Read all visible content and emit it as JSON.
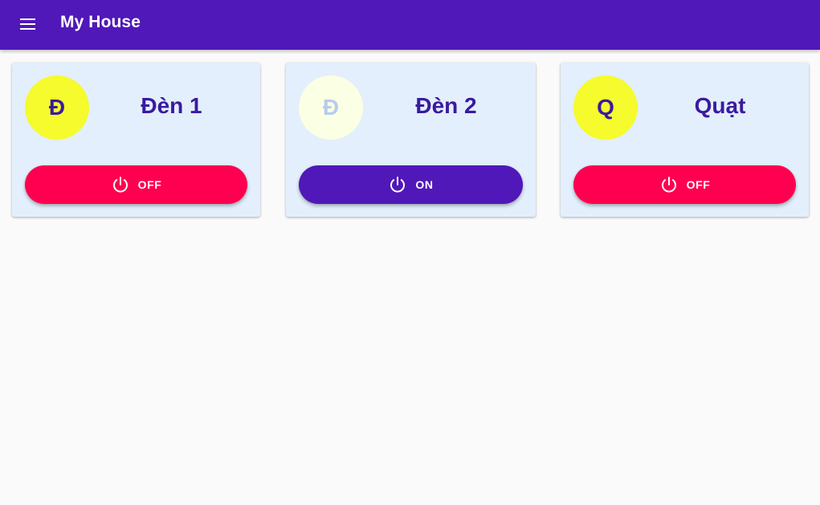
{
  "app_bar": {
    "title": "My House",
    "menu_icon": "menu-icon",
    "background": "#5018b8"
  },
  "devices": [
    {
      "initial": "Đ",
      "name": "Đèn 1",
      "state_label": "OFF",
      "state": "off",
      "avatar_bg": "#f5fb2c",
      "avatar_fg": "#3a1aa0",
      "button_color": "#ff0050",
      "icon": "power-icon"
    },
    {
      "initial": "Đ",
      "name": "Đèn 2",
      "state_label": "ON",
      "state": "on",
      "avatar_bg": "#fbffe3",
      "avatar_fg": "#b5ccef",
      "button_color": "#5018b8",
      "icon": "power-icon"
    },
    {
      "initial": "Q",
      "name": "Quạt",
      "state_label": "OFF",
      "state": "off",
      "avatar_bg": "#f5fb2c",
      "avatar_fg": "#3a1aa0",
      "button_color": "#ff0050",
      "icon": "power-icon"
    }
  ]
}
